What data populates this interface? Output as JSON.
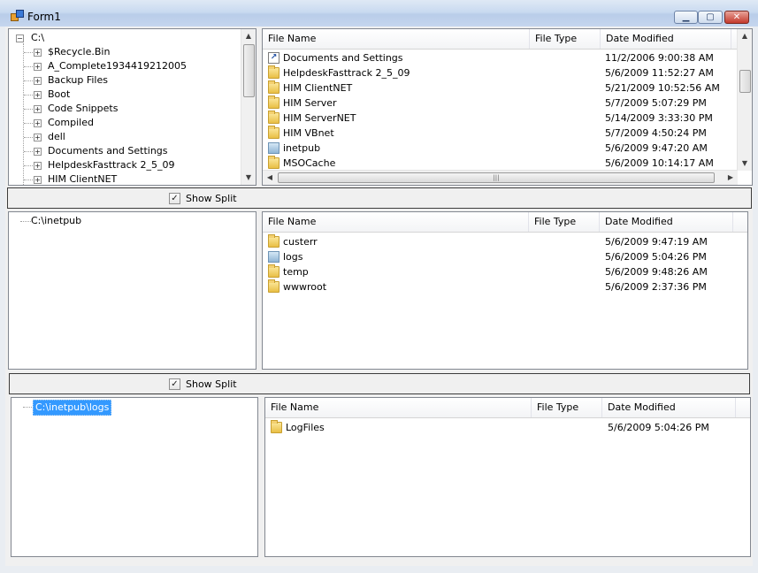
{
  "window": {
    "title": "Form1",
    "min_glyph": "▁",
    "max_glyph": "▢",
    "close_glyph": "✕"
  },
  "top": {
    "tree": {
      "root": "C:\\",
      "items": [
        "$Recycle.Bin",
        "A_Complete1934419212005",
        "Backup Files",
        "Boot",
        "Code Snippets",
        "Compiled",
        "dell",
        "Documents and Settings",
        "HelpdeskFasttrack 2_5_09",
        "HIM ClientNET"
      ]
    },
    "list": {
      "columns": [
        "File Name",
        "File Type",
        "Date Modified"
      ],
      "rows": [
        {
          "name": "Documents and Settings",
          "type": "",
          "date": "11/2/2006 9:00:38 AM",
          "icon": "shortcut-icon"
        },
        {
          "name": "HelpdeskFasttrack 2_5_09",
          "type": "",
          "date": "5/6/2009 11:52:27 AM",
          "icon": "folder-icon"
        },
        {
          "name": "HIM ClientNET",
          "type": "",
          "date": "5/21/2009 10:52:56 AM",
          "icon": "folder-icon"
        },
        {
          "name": "HIM Server",
          "type": "",
          "date": "5/7/2009 5:07:29 PM",
          "icon": "folder-icon"
        },
        {
          "name": "HIM ServerNET",
          "type": "",
          "date": "5/14/2009 3:33:30 PM",
          "icon": "folder-icon"
        },
        {
          "name": "HIM VBnet",
          "type": "",
          "date": "5/7/2009 4:50:24 PM",
          "icon": "folder-icon"
        },
        {
          "name": "inetpub",
          "type": "",
          "date": "5/6/2009 9:47:20 AM",
          "icon": "blue-folder-icon"
        },
        {
          "name": "MSOCache",
          "type": "",
          "date": "5/6/2009 10:14:17 AM",
          "icon": "folder-icon"
        }
      ]
    }
  },
  "split1": {
    "label": "Show Split",
    "checked": "✓"
  },
  "middle": {
    "tree": {
      "root": "C:\\inetpub"
    },
    "list": {
      "columns": [
        "File Name",
        "File Type",
        "Date Modified"
      ],
      "rows": [
        {
          "name": "custerr",
          "type": "",
          "date": "5/6/2009 9:47:19 AM",
          "icon": "folder-icon"
        },
        {
          "name": "logs",
          "type": "",
          "date": "5/6/2009 5:04:26 PM",
          "icon": "blue-folder-icon"
        },
        {
          "name": "temp",
          "type": "",
          "date": "5/6/2009 9:48:26 AM",
          "icon": "folder-icon"
        },
        {
          "name": "wwwroot",
          "type": "",
          "date": "5/6/2009 2:37:36 PM",
          "icon": "folder-icon"
        }
      ]
    }
  },
  "split2": {
    "label": "Show Split",
    "checked": "✓"
  },
  "bottom": {
    "tree": {
      "root": "C:\\inetpub\\logs"
    },
    "list": {
      "columns": [
        "File Name",
        "File Type",
        "Date Modified"
      ],
      "rows": [
        {
          "name": "LogFiles",
          "type": "",
          "date": "5/6/2009 5:04:26 PM",
          "icon": "folder-icon"
        }
      ]
    }
  },
  "scroll_glyphs": {
    "up": "▲",
    "down": "▼",
    "left": "◀",
    "right": "▶",
    "grip": "|||"
  }
}
